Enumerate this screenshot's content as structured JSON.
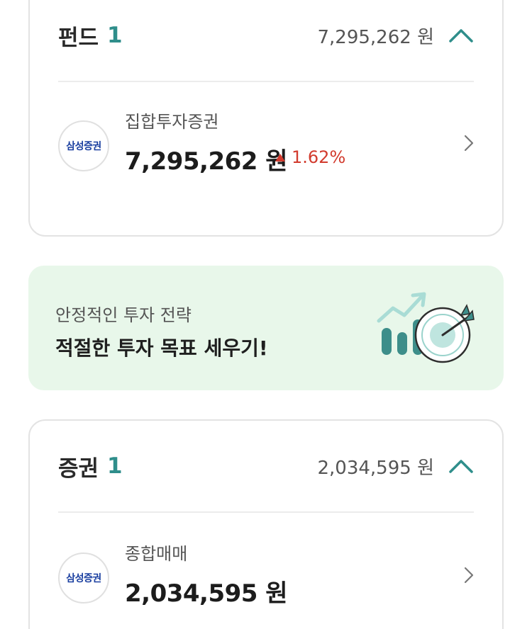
{
  "fund_section": {
    "title": "펀드",
    "count": "1",
    "total": "7,295,262 원",
    "account": {
      "logo_text": "삼성증권",
      "name": "집합투자증권",
      "amount": "7,295,262 원",
      "change": "1.62%"
    }
  },
  "banner": {
    "subtitle": "안정적인 투자 전략",
    "title": "적절한 투자 목표 세우기!"
  },
  "securities_section": {
    "title": "증권",
    "count": "1",
    "total": "2,034,595 원",
    "account": {
      "logo_text": "삼성증권",
      "name": "종합매매",
      "amount": "2,034,595 원"
    }
  },
  "colors": {
    "accent_teal": "#2f8e8b",
    "gain_red": "#d23b2e",
    "banner_bg": "#e8f7ea",
    "brand_blue": "#1a3fa0"
  },
  "icons": [
    "chevron-up-icon",
    "chevron-right-icon",
    "triangle-up-icon",
    "target-chart-illustration"
  ]
}
